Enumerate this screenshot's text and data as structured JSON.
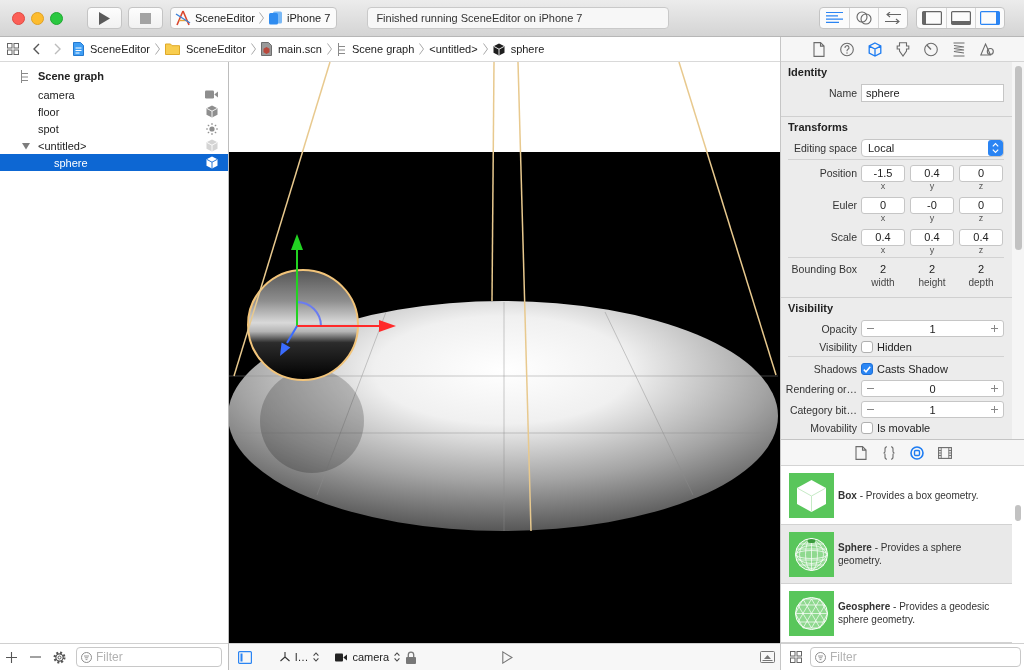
{
  "toolbar": {
    "scheme": "SceneEditor",
    "destination": "iPhone 7",
    "status": "Finished running SceneEditor on iPhone 7",
    "editor_modes": [
      {
        "selected": true
      },
      {
        "selected": false
      },
      {
        "selected": false
      }
    ],
    "panels": [
      {
        "on": false
      },
      {
        "on": false
      },
      {
        "on": true
      }
    ]
  },
  "jump_bar": {
    "history": [
      {
        "disabled": false
      },
      {
        "disabled": true
      }
    ],
    "path": [
      {
        "kind": "project",
        "label": "SceneEditor"
      },
      {
        "kind": "folder",
        "label": "SceneEditor"
      },
      {
        "kind": "scene",
        "label": "main.scn"
      },
      {
        "kind": "graph",
        "label": "Scene graph"
      },
      {
        "kind": "node",
        "label": "<untitled>"
      },
      {
        "kind": "geometry",
        "label": "sphere"
      }
    ]
  },
  "navigator": {
    "title": "Scene graph",
    "items": [
      {
        "label": "camera",
        "kind": "camera",
        "selected": false
      },
      {
        "label": "floor",
        "kind": "geometry",
        "selected": false
      },
      {
        "label": "spot",
        "kind": "light",
        "selected": false
      },
      {
        "label": "<untitled>",
        "kind": "node",
        "selected": false,
        "expanded": true,
        "children": [
          {
            "label": "sphere",
            "kind": "geometry",
            "selected": true
          }
        ]
      }
    ],
    "filter": {
      "placeholder": "Filter"
    }
  },
  "viewport": {
    "axis": "l…",
    "camera": "camera"
  },
  "inspector": {
    "tabs": [
      {
        "selected": false
      },
      {
        "selected": false
      },
      {
        "selected": true
      },
      {
        "selected": false
      },
      {
        "selected": false
      },
      {
        "selected": false
      },
      {
        "selected": false
      }
    ],
    "sections": [
      {
        "title": "Identity",
        "groups": [
          [
            {
              "kind": "text",
              "label": "Name",
              "value": "sphere"
            }
          ]
        ]
      },
      {
        "title": "Transforms",
        "groups": [
          [
            {
              "kind": "popup",
              "label": "Editing space",
              "value": "Local"
            }
          ],
          [
            {
              "kind": "vector",
              "label": "Position",
              "values": [
                {
                  "value": "-1.5",
                  "axis": "x"
                },
                {
                  "value": "0.4",
                  "axis": "y"
                },
                {
                  "value": "0",
                  "axis": "z"
                }
              ]
            },
            {
              "kind": "vector",
              "label": "Euler",
              "values": [
                {
                  "value": "0",
                  "axis": "x"
                },
                {
                  "value": "-0",
                  "axis": "y"
                },
                {
                  "value": "0",
                  "axis": "z"
                }
              ]
            },
            {
              "kind": "vector",
              "label": "Scale",
              "values": [
                {
                  "value": "0.4",
                  "axis": "x"
                },
                {
                  "value": "0.4",
                  "axis": "y"
                },
                {
                  "value": "0.4",
                  "axis": "z"
                }
              ]
            }
          ],
          [
            {
              "kind": "readout",
              "label": "Bounding Box",
              "values": [
                {
                  "value": "2",
                  "axis": "width"
                },
                {
                  "value": "2",
                  "axis": "height"
                },
                {
                  "value": "2",
                  "axis": "depth"
                }
              ]
            }
          ]
        ]
      },
      {
        "title": "Visibility",
        "groups": [
          [
            {
              "kind": "stepper",
              "label": "Opacity",
              "value": "1"
            },
            {
              "kind": "checkbox",
              "label": "Visibility",
              "option": "Hidden",
              "checked": false
            }
          ],
          [
            {
              "kind": "checkbox",
              "label": "Shadows",
              "option": "Casts Shadow",
              "checked": true
            },
            {
              "kind": "stepper",
              "label": "Rendering or…",
              "value": "0"
            },
            {
              "kind": "stepper",
              "label": "Category bit…",
              "value": "1"
            },
            {
              "kind": "checkbox",
              "label": "Movability",
              "option": "Is movable",
              "checked": false
            }
          ]
        ]
      }
    ]
  },
  "library": {
    "tabs": [
      {
        "selected": false
      },
      {
        "selected": false
      },
      {
        "selected": true
      },
      {
        "selected": false
      }
    ],
    "items": [
      {
        "kind": "box",
        "text": "**Box** - Provides a box geometry.",
        "selected": false
      },
      {
        "kind": "sphere",
        "text": "**Sphere** - Provides a sphere geometry.",
        "selected": true
      },
      {
        "kind": "geosphere",
        "text": "**Geosphere** - Provides a geodesic sphere geometry.",
        "selected": false
      }
    ],
    "filter": {
      "placeholder": "Filter"
    }
  }
}
